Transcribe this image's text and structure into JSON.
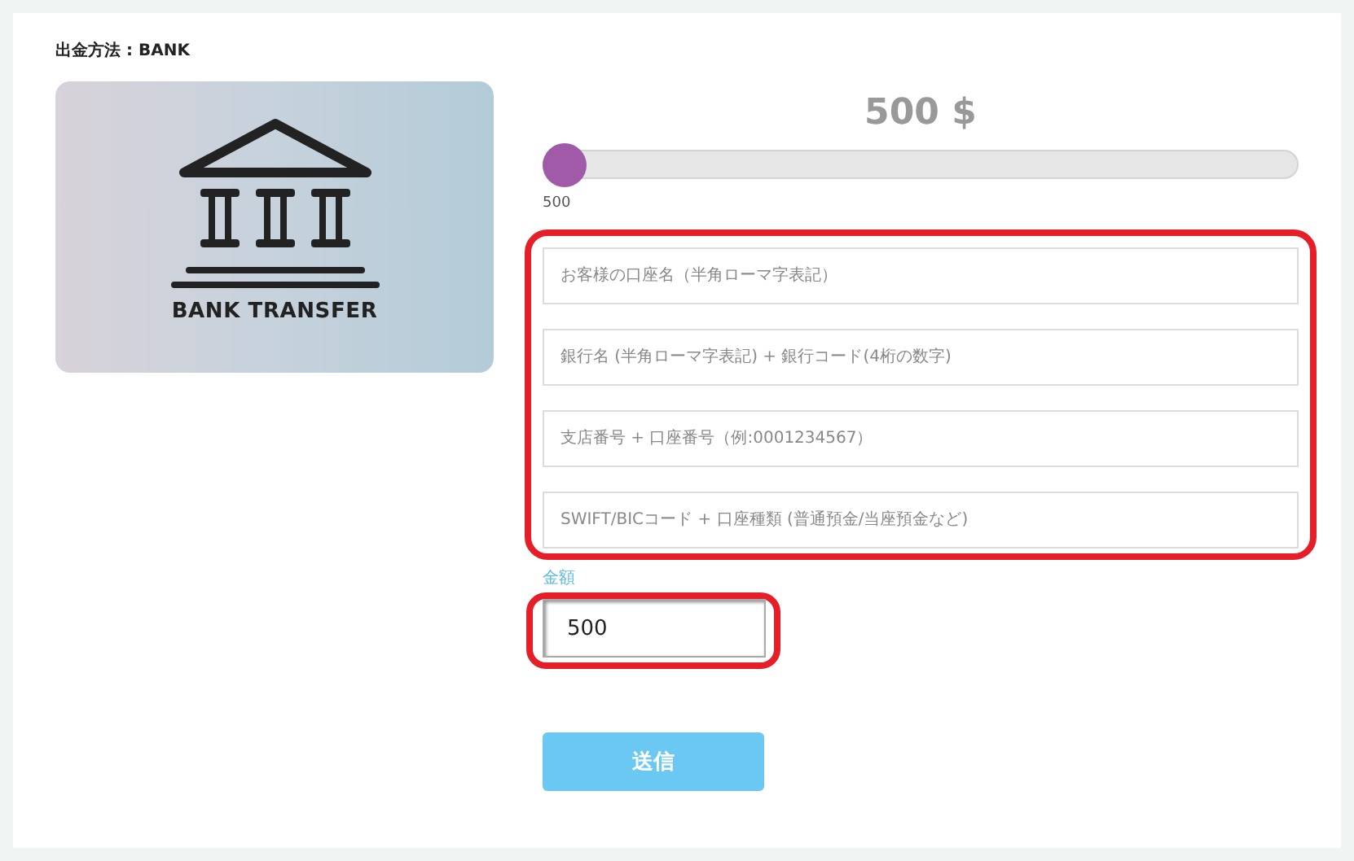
{
  "heading": "出金方法 : BANK",
  "method_card": {
    "caption": "BANK TRANSFER"
  },
  "amount_display": "500 $",
  "slider": {
    "level": 0,
    "min_label": "500"
  },
  "account_fields": {
    "highlighted": true,
    "fields": [
      {
        "placeholder": "お客様の口座名（半角ローマ字表記）"
      },
      {
        "placeholder": "銀行名 (半角ローマ字表記) + 銀行コード(4桁の数字)"
      },
      {
        "placeholder": "支店番号 + 口座番号（例:0001234567）"
      },
      {
        "placeholder": "SWIFT/BICコード + 口座種類 (普通預金/当座預金など)"
      }
    ]
  },
  "amount_field": {
    "label": "金額",
    "value": "500",
    "highlighted": true
  },
  "submit_button": "送信"
}
